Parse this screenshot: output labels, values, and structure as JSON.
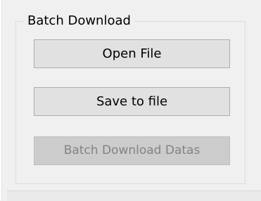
{
  "batch_download": {
    "title": "Batch Download",
    "buttons": {
      "open_file": "Open File",
      "save_to_file": "Save to file",
      "batch_download_datas": "Batch Download Datas"
    },
    "batch_download_enabled": false
  }
}
